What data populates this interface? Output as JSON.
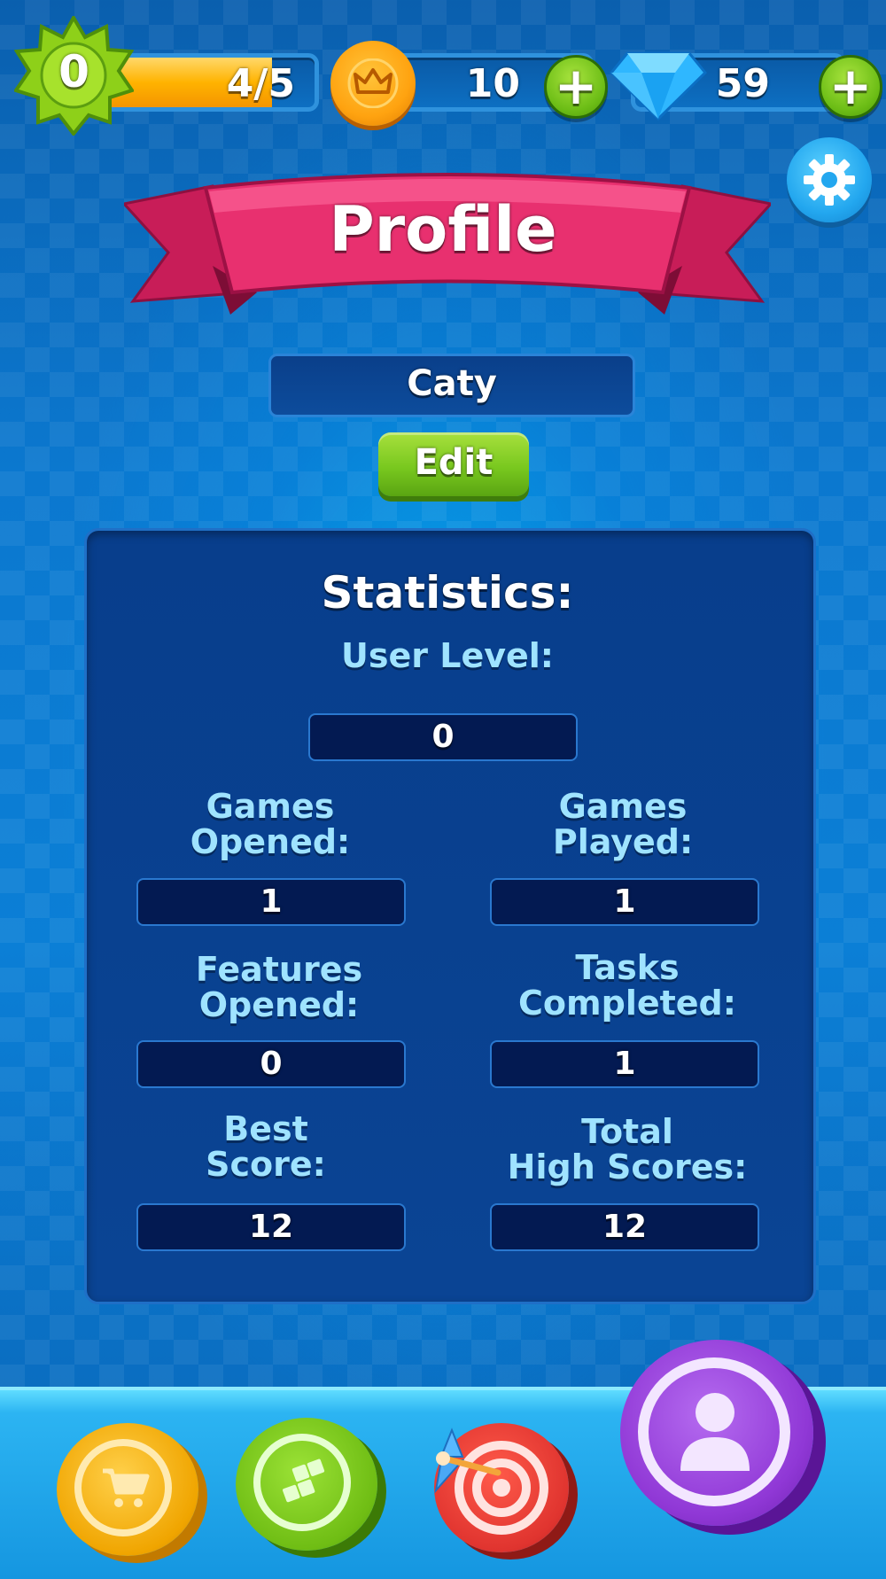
{
  "hud": {
    "level": "0",
    "xp_progress_text": "4/5",
    "xp_progress_fraction": 0.8,
    "coins": "10",
    "gems": "59",
    "plus_symbol": "+"
  },
  "header": {
    "title": "Profile"
  },
  "profile": {
    "username": "Caty",
    "edit_label": "Edit"
  },
  "statistics": {
    "heading": "Statistics:",
    "user_level": {
      "label": "User Level:",
      "value": "0"
    },
    "games_opened": {
      "label_line1": "Games",
      "label_line2": "Opened:",
      "value": "1"
    },
    "games_played": {
      "label_line1": "Games",
      "label_line2": "Played:",
      "value": "1"
    },
    "features_opened": {
      "label_line1": "Features",
      "label_line2": "Opened:",
      "value": "0"
    },
    "tasks_completed": {
      "label_line1": "Tasks",
      "label_line2": "Completed:",
      "value": "1"
    },
    "best_score": {
      "label_line1": "Best",
      "label_line2": "Score:",
      "value": "12"
    },
    "total_high_scores": {
      "label_line1": "Total",
      "label_line2": "High Scores:",
      "value": "12"
    }
  },
  "navigation": {
    "items": [
      {
        "icon": "shopping-cart-icon",
        "color": "#f7b500"
      },
      {
        "icon": "blocks-icon",
        "color": "#7cc41c"
      },
      {
        "icon": "target-icon",
        "color": "#e0342f"
      },
      {
        "icon": "user-icon",
        "color": "#9b3fd8",
        "active": true
      }
    ]
  },
  "colors": {
    "background": "#0b78cf",
    "ribbon": "#e3296b",
    "panel": "#083e8c",
    "label_text": "#9fe3ff",
    "accent_green": "#79c81f"
  }
}
